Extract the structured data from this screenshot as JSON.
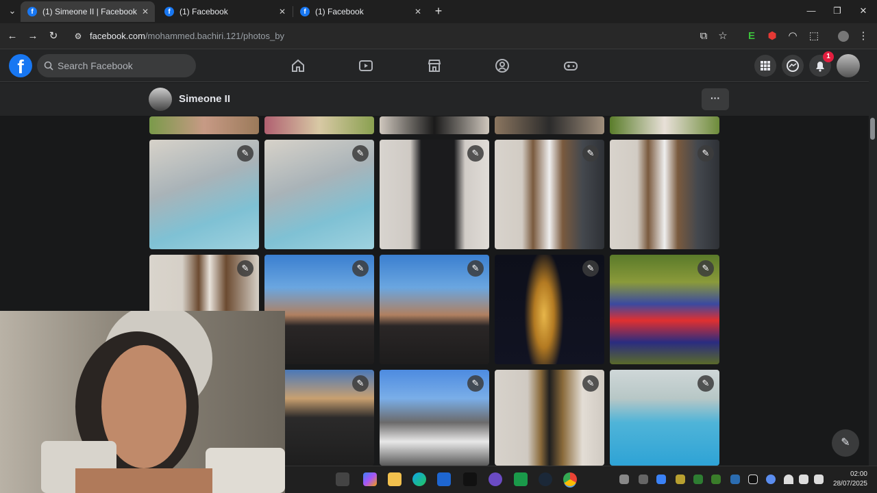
{
  "browser": {
    "tabs": [
      {
        "title": "(1) Simeone II | Facebook",
        "favicon": "f"
      },
      {
        "title": "(1) Facebook",
        "favicon": "f"
      },
      {
        "title": "(1) Facebook",
        "favicon": "f"
      }
    ],
    "new_tab": "+",
    "url": {
      "host": "facebook.com",
      "path": "/mohammed.bachiri.121/photos_by"
    },
    "extension_label": "E"
  },
  "facebook": {
    "logo": "f",
    "search": {
      "placeholder": "Search Facebook"
    },
    "notification_count": "1",
    "profile": {
      "name": "Simeone II",
      "more": "···"
    }
  },
  "photos": {
    "edit_glyph": "✎",
    "rows": 4
  },
  "taskbar": {
    "time": "02:00",
    "date": "28/07/2025"
  },
  "colors": {
    "fb_blue": "#1877f2",
    "bg": "#18191a",
    "surface": "#242526"
  }
}
